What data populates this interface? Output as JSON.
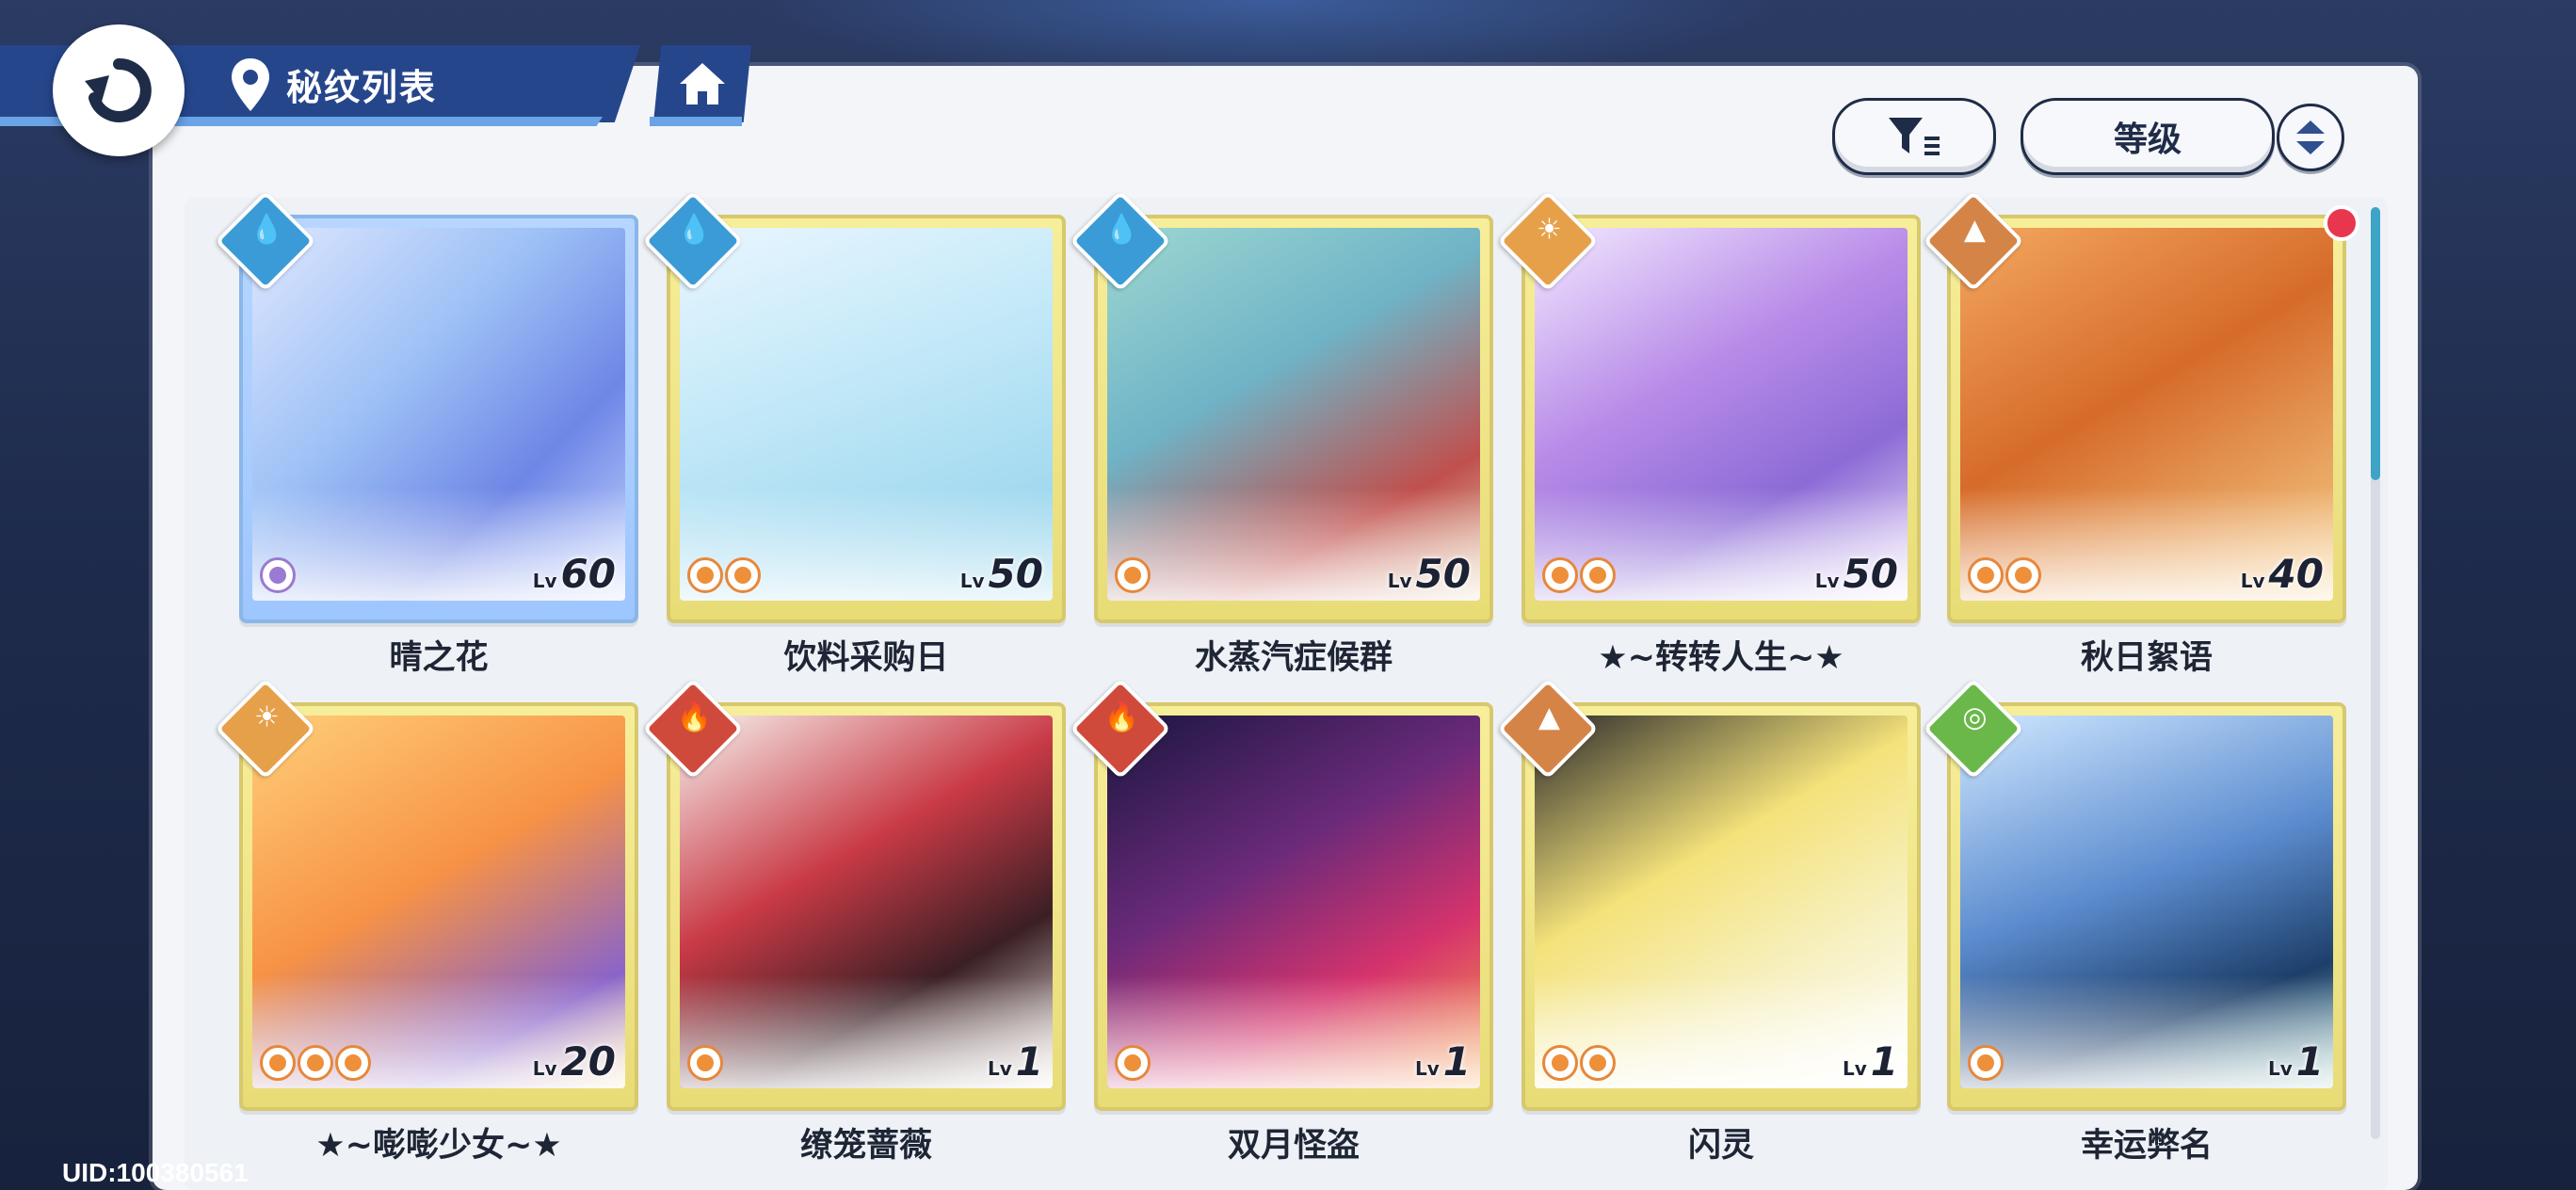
{
  "header": {
    "title": "秘纹列表"
  },
  "toolbar": {
    "sort_label": "等级"
  },
  "cards": [
    {
      "title": "晴之花",
      "level": "60",
      "element": "water",
      "coins": 1
    },
    {
      "title": "饮料采购日",
      "level": "50",
      "element": "water",
      "coins": 2
    },
    {
      "title": "水蒸汽症候群",
      "level": "50",
      "element": "water",
      "coins": 1
    },
    {
      "title": "★~转转人生~★",
      "level": "50",
      "element": "light",
      "coins": 2
    },
    {
      "title": "秋日絮语",
      "level": "40",
      "element": "earth",
      "coins": 2
    },
    {
      "title": "★~嘭嘭少女~★",
      "level": "20",
      "element": "light",
      "coins": 3
    },
    {
      "title": "缭笼蔷薇",
      "level": "1",
      "element": "fire",
      "coins": 1
    },
    {
      "title": "双月怪盗",
      "level": "1",
      "element": "fire",
      "coins": 1
    },
    {
      "title": "闪灵",
      "level": "1",
      "element": "earth",
      "coins": 2
    },
    {
      "title": "幸运弊名",
      "level": "1",
      "element": "wind",
      "coins": 1
    }
  ],
  "level_prefix": "Lv",
  "footer": {
    "uid": "UID:100380561"
  },
  "colors": {
    "water": "#3a9bd6",
    "light": "#e7a04a",
    "earth": "#d58447",
    "fire": "#cf4a3b",
    "wind": "#6ab84a",
    "accent": "#26468c"
  }
}
